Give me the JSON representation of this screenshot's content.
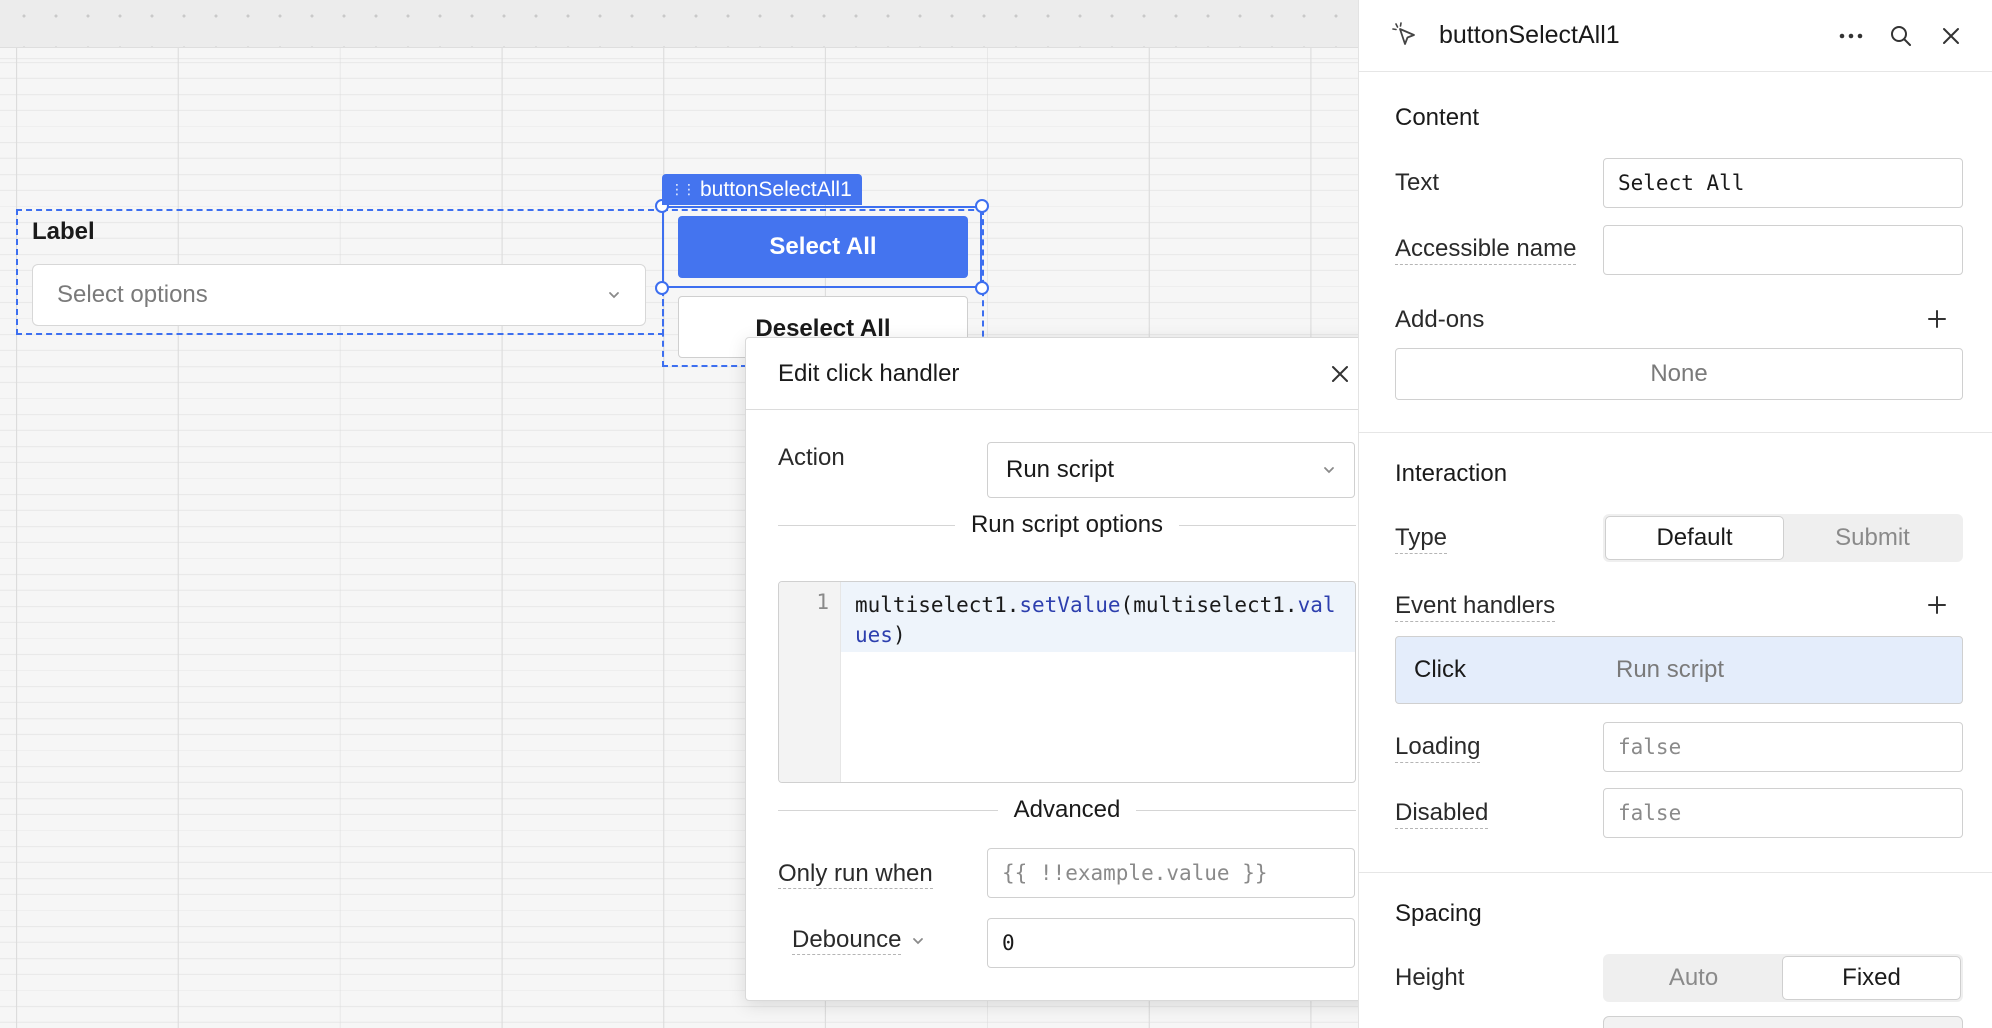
{
  "canvas": {
    "multiselect": {
      "label": "Label",
      "placeholder": "Select options"
    },
    "component_tag": "buttonSelectAll1",
    "select_all_button": "Select All",
    "deselect_all_button": "Deselect All"
  },
  "modal": {
    "title": "Edit click handler",
    "action_label": "Action",
    "action_value": "Run script",
    "run_script_options_label": "Run script options",
    "code": {
      "line_number": "1",
      "object": "multiselect1",
      "dot1": ".",
      "method": "setValue",
      "open": "(",
      "arg_object": "multiselect1",
      "dot2": ".",
      "arg_prop": "values",
      "close": ")"
    },
    "advanced_label": "Advanced",
    "only_run_when_label": "Only run when",
    "only_run_when_placeholder": "{{ !!example.value }}",
    "debounce_label": "Debounce",
    "debounce_value": "0"
  },
  "inspector": {
    "title": "buttonSelectAll1",
    "content": {
      "section_title": "Content",
      "text_label": "Text",
      "text_value": "Select All",
      "accessible_name_label": "Accessible name",
      "accessible_name_value": "",
      "addons_label": "Add-ons",
      "addons_value": "None"
    },
    "interaction": {
      "section_title": "Interaction",
      "type_label": "Type",
      "type_options": [
        "Default",
        "Submit"
      ],
      "type_selected": "Default",
      "event_handlers_label": "Event handlers",
      "event_handler": {
        "event": "Click",
        "action": "Run script"
      },
      "loading_label": "Loading",
      "loading_value": "false",
      "disabled_label": "Disabled",
      "disabled_value": "false"
    },
    "spacing": {
      "section_title": "Spacing",
      "height_label": "Height",
      "height_options": [
        "Auto",
        "Fixed"
      ],
      "height_selected": "Fixed"
    }
  },
  "colors": {
    "accent": "#4474ef",
    "selection": "#3d6ff0",
    "code_method": "#2d3fae",
    "event_row_bg": "#e4edfb"
  }
}
